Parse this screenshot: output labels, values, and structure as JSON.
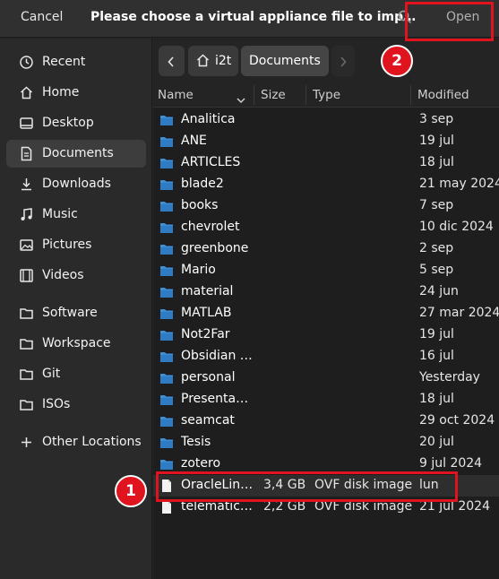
{
  "header": {
    "cancel_label": "Cancel",
    "title": "Please choose a virtual appliance file to imp…",
    "open_label": "Open"
  },
  "sidebar": {
    "items": [
      {
        "label": "Recent",
        "icon": "clock-icon"
      },
      {
        "label": "Home",
        "icon": "home-icon"
      },
      {
        "label": "Desktop",
        "icon": "desktop-icon"
      },
      {
        "label": "Documents",
        "icon": "document-icon",
        "active": true
      },
      {
        "label": "Downloads",
        "icon": "download-icon"
      },
      {
        "label": "Music",
        "icon": "music-icon"
      },
      {
        "label": "Pictures",
        "icon": "picture-icon"
      },
      {
        "label": "Videos",
        "icon": "video-icon"
      },
      {
        "label": "Software",
        "icon": "folder-icon"
      },
      {
        "label": "Workspace",
        "icon": "folder-icon"
      },
      {
        "label": "Git",
        "icon": "folder-icon"
      },
      {
        "label": "ISOs",
        "icon": "folder-icon"
      },
      {
        "label": "Other Locations",
        "icon": "plus-icon"
      }
    ]
  },
  "pathbar": {
    "home_label": "i2t",
    "current_label": "Documents"
  },
  "columns": {
    "name": "Name",
    "size": "Size",
    "type": "Type",
    "modified": "Modified"
  },
  "files": [
    {
      "name": "Analitica",
      "size": "",
      "type": "",
      "modified": "3 sep",
      "kind": "folder"
    },
    {
      "name": "ANE",
      "size": "",
      "type": "",
      "modified": "19 jul",
      "kind": "folder"
    },
    {
      "name": "ARTICLES",
      "size": "",
      "type": "",
      "modified": "18 jul",
      "kind": "folder"
    },
    {
      "name": "blade2",
      "size": "",
      "type": "",
      "modified": "21 may 2024",
      "kind": "folder"
    },
    {
      "name": "books",
      "size": "",
      "type": "",
      "modified": "7 sep",
      "kind": "folder"
    },
    {
      "name": "chevrolet",
      "size": "",
      "type": "",
      "modified": "10 dic 2024",
      "kind": "folder"
    },
    {
      "name": "greenbone",
      "size": "",
      "type": "",
      "modified": "2 sep",
      "kind": "folder"
    },
    {
      "name": "Mario",
      "size": "",
      "type": "",
      "modified": "5 sep",
      "kind": "folder"
    },
    {
      "name": "material",
      "size": "",
      "type": "",
      "modified": "24 jun",
      "kind": "folder"
    },
    {
      "name": "MATLAB",
      "size": "",
      "type": "",
      "modified": "27 mar 2024",
      "kind": "folder"
    },
    {
      "name": "Not2Far",
      "size": "",
      "type": "",
      "modified": "19 jul",
      "kind": "folder"
    },
    {
      "name": "Obsidian …",
      "size": "",
      "type": "",
      "modified": "16 jul",
      "kind": "folder"
    },
    {
      "name": "personal",
      "size": "",
      "type": "",
      "modified": "Yesterday",
      "kind": "folder"
    },
    {
      "name": "Presenta…",
      "size": "",
      "type": "",
      "modified": "18 jul",
      "kind": "folder"
    },
    {
      "name": "seamcat",
      "size": "",
      "type": "",
      "modified": "29 oct 2024",
      "kind": "folder"
    },
    {
      "name": "Tesis",
      "size": "",
      "type": "",
      "modified": "20 jul",
      "kind": "folder"
    },
    {
      "name": "zotero",
      "size": "",
      "type": "",
      "modified": "9 jul 2024",
      "kind": "folder"
    },
    {
      "name": "OracleLin…",
      "size": "3,4 GB",
      "type": "OVF disk image",
      "modified": "lun",
      "kind": "file",
      "selected": true
    },
    {
      "name": "telematic…",
      "size": "2,2 GB",
      "type": "OVF disk image",
      "modified": "21 jul 2024",
      "kind": "file"
    }
  ],
  "annotations": {
    "badge_1": "1",
    "badge_2": "2"
  },
  "colors": {
    "accent_folder": "#3d8fd6",
    "annotation": "#e0141e"
  }
}
